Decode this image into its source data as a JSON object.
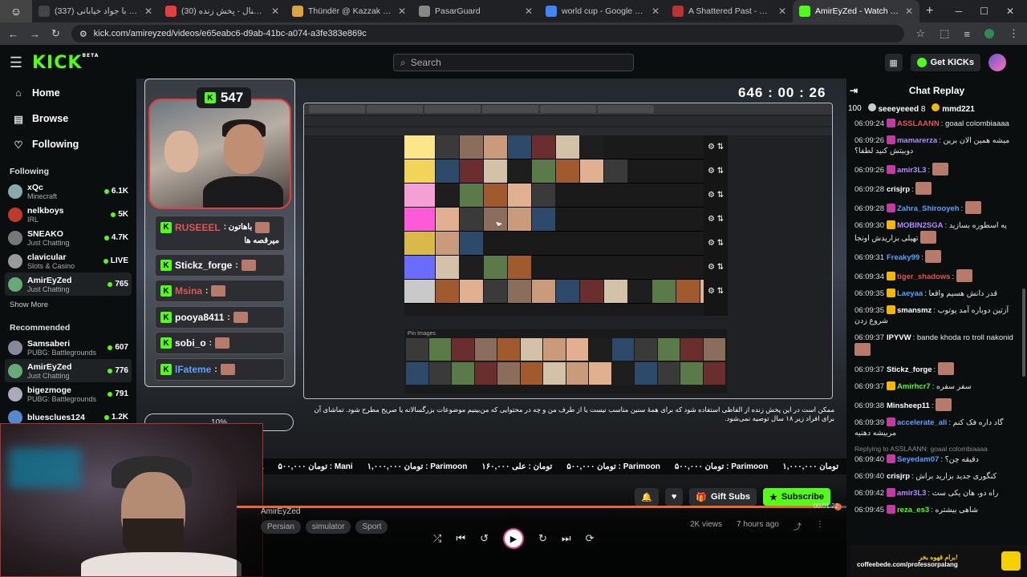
{
  "browser": {
    "tabs": [
      {
        "title": "مصر و آرژانتین با جواد خیابانی (337)",
        "active": false,
        "fav": "#444"
      },
      {
        "title": "ایران اینترنشنال - پخش زنده (30)",
        "active": false,
        "fav": "#e53e3e"
      },
      {
        "title": "Thündër @ Kazzak (EU EN)",
        "active": false,
        "fav": "#d9a441"
      },
      {
        "title": "PasarGuard",
        "active": false,
        "fav": "#888"
      },
      {
        "title": "world cup - Google Search",
        "active": false,
        "fav": "#4285f4"
      },
      {
        "title": "A Shattered Past - Quest - Wor",
        "active": false,
        "fav": "#b33"
      },
      {
        "title": "AmirEyZed - Watch the VOD",
        "active": true,
        "fav": "#53fc18"
      }
    ],
    "url": "kick.com/amireyzed/videos/e65eabc6-d9ab-41bc-a074-a3fe383e869c",
    "ext_letter": "a"
  },
  "header": {
    "logo": "KICK",
    "logo_beta": "BETA",
    "search_placeholder": "Search",
    "get_kicks": "Get KICKs"
  },
  "sidebar": {
    "nav": [
      {
        "label": "Home",
        "icon": "home-icon",
        "glyph": "⌂"
      },
      {
        "label": "Browse",
        "icon": "browse-icon",
        "glyph": "▤"
      },
      {
        "label": "Following",
        "icon": "heart-icon",
        "glyph": "♡"
      }
    ],
    "following_title": "Following",
    "following": [
      {
        "name": "xQc",
        "cat": "Minecraft",
        "viewers": "6.1K",
        "color": "#8aa"
      },
      {
        "name": "nelkboys",
        "cat": "IRL",
        "viewers": "5K",
        "color": "#c0392b"
      },
      {
        "name": "SNEAKO",
        "cat": "Just Chatting",
        "viewers": "4.7K",
        "color": "#777"
      },
      {
        "name": "clavicular",
        "cat": "Slots & Casino",
        "viewers": "LIVE",
        "color": "#999"
      },
      {
        "name": "AmirEyZed",
        "cat": "Just Chatting",
        "viewers": "765",
        "color": "#6a7",
        "selected": true
      }
    ],
    "show_more": "Show More",
    "recommended_title": "Recommended",
    "recommended": [
      {
        "name": "Samsaberi",
        "cat": "PUBG: Battlegrounds",
        "viewers": "607",
        "color": "#889"
      },
      {
        "name": "AmirEyZed",
        "cat": "Just Chatting",
        "viewers": "776",
        "color": "#6a7",
        "selected": true
      },
      {
        "name": "bigezmoge",
        "cat": "PUBG: Battlegrounds",
        "viewers": "791",
        "color": "#aab"
      },
      {
        "name": "bluesclues124",
        "cat": "",
        "viewers": "1.2K",
        "color": "#58c"
      }
    ]
  },
  "stage": {
    "counter": "547",
    "timer": "646 : 00 : 26",
    "overlay_chat": [
      {
        "user": "RUSEEEL",
        "text": ": باهاتون",
        "line2": "میرقصه ها",
        "color": "#e05555"
      },
      {
        "user": "Stickz_forge",
        "text": ":",
        "color": "#fff"
      },
      {
        "user": "Msina",
        "text": ":",
        "color": "#e05555"
      },
      {
        "user": "pooya8411",
        "text": ":",
        "color": "#fff"
      },
      {
        "user": "sobi_o",
        "text": ":",
        "color": "#fff"
      },
      {
        "user": "lFateme",
        "text": ":",
        "color": "#5aa0ff"
      }
    ],
    "pill": "10%",
    "pool_label": "Pin Images",
    "disclaimer": "ممکن است در این پخش زنده از الفاظی استفاده شود که برای همهٔ سنین مناسب نیست یا از طرف من و چه در محتوایی که من‌بینیم موضوعات بزرگسالانه یا صریح مطرح شود. تماشای آن برای افراد زیر ۱۸ سال توصیه نمی‌شود.",
    "ticker": [
      "۲۰۰,۰۰۰ تومان : Media",
      "۵۰۰,۰۰۰ تومان : Mani",
      "۱,۰۰۰,۰۰۰ تومان : Parimoon",
      "۱۶۰,۰۰۰ تومان : علی",
      "۵۰۰,۰۰۰ تومان : Parimoon",
      "۵۰۰,۰۰۰ تومان : Parimoon",
      "۱,۰۰۰,۰۰۰ تومان"
    ]
  },
  "player": {
    "gift_subs": "Gift Subs",
    "subscribe": "Subscribe",
    "time": "00:01:22",
    "channel": "AmirEyZed",
    "tags": [
      "Persian",
      "simulator",
      "Sport"
    ],
    "views": "2K views",
    "ago": "7 hours ago",
    "progress": 0.96
  },
  "chat": {
    "title": "Chat Replay",
    "pinned": [
      {
        "count": "100"
      },
      {
        "user": "seeeyeeed",
        "count": "8"
      },
      {
        "user": "mmd221"
      }
    ],
    "messages": [
      {
        "t": "06:09:24",
        "u": "ASSLAANN",
        "c": "#e05555",
        "txt": ": goaal colombiaaaa",
        "b": "#c43aa3"
      },
      {
        "t": "06:09:26",
        "u": "mamarerza",
        "c": "#b48cff",
        "txt": ": میشه همین الان برین دوبیتش کنید لطفا؟",
        "b": "#c43aa3"
      },
      {
        "t": "06:09:26",
        "u": "amir3L3",
        "c": "#b48cff",
        "txt": ":",
        "em": true,
        "b": "#c43aa3"
      },
      {
        "t": "06:09:28",
        "u": "crisjrp",
        "c": "#fff",
        "txt": ":",
        "em": true
      },
      {
        "t": "06:09:28",
        "u": "Zahra_Shirooyeh",
        "c": "#5aa0ff",
        "txt": ":",
        "em": true,
        "b": "#c43aa3"
      },
      {
        "t": "06:09:30",
        "u": "MOBIN2SGA",
        "c": "#b48cff",
        "txt": ": یه اسطوره بسازید تهیلی بزاریدش اونجا",
        "b": "#f5b800",
        "em": true
      },
      {
        "t": "06:09:31",
        "u": "Freaky99",
        "c": "#5aa0ff",
        "txt": ":",
        "em": true
      },
      {
        "t": "06:09:34",
        "u": "tiger_shadows",
        "c": "#e05555",
        "txt": ":",
        "em": true,
        "b": "#f5b800"
      },
      {
        "t": "06:09:35",
        "u": "Laeyaa",
        "c": "#5aa0ff",
        "txt": ": قدر دانش هسیم واقعا",
        "b": "#f5b800"
      },
      {
        "t": "06:09:35",
        "u": "smansmz",
        "c": "#fff",
        "txt": ": آزتین دوباره آمد یوتوب شروع زدن",
        "b": "#f5b800"
      },
      {
        "t": "06:09:37",
        "u": "IPYVW",
        "c": "#fff",
        "txt": ": bande khoda ro troll nakonid",
        "em": true
      },
      {
        "t": "06:09:37",
        "u": "Stickz_forge",
        "c": "#fff",
        "txt": ":",
        "em": true
      },
      {
        "t": "06:09:37",
        "u": "Amirhcr7",
        "c": "#53fc18",
        "txt": ": سفر سفره",
        "b": "#f5b800"
      },
      {
        "t": "06:09:38",
        "u": "Minsheep11",
        "c": "#fff",
        "txt": ":",
        "em": true
      },
      {
        "t": "06:09:39",
        "u": "accelerate_ali",
        "c": "#5aa0ff",
        "txt": ": گاد داره فک کنم مربیشه دهنیه",
        "b": "#c43aa3"
      },
      {
        "reply": "Replying to ASSLAANN: goaal colombiaaaa",
        "t": "06:09:40",
        "u": "Seyedam07",
        "c": "#5aa0ff",
        "txt": ": دقیقه چن؟",
        "b": "#c43aa3"
      },
      {
        "t": "06:09:40",
        "u": "crisjrp",
        "c": "#fff",
        "txt": ": کنگوری جدید بزارید براش"
      },
      {
        "t": "06:09:42",
        "u": "amir3L3",
        "c": "#b48cff",
        "txt": ": راه دو، هان یکی ست",
        "b": "#c43aa3"
      },
      {
        "t": "06:09:45",
        "u": "reza_es3",
        "c": "#53fc18",
        "txt": ": شاهی بیشتره",
        "b": "#c43aa3"
      }
    ]
  },
  "promo": {
    "line1": "برام قهوه بخر!",
    "line2": "coffeebede.com/professorpalang"
  }
}
